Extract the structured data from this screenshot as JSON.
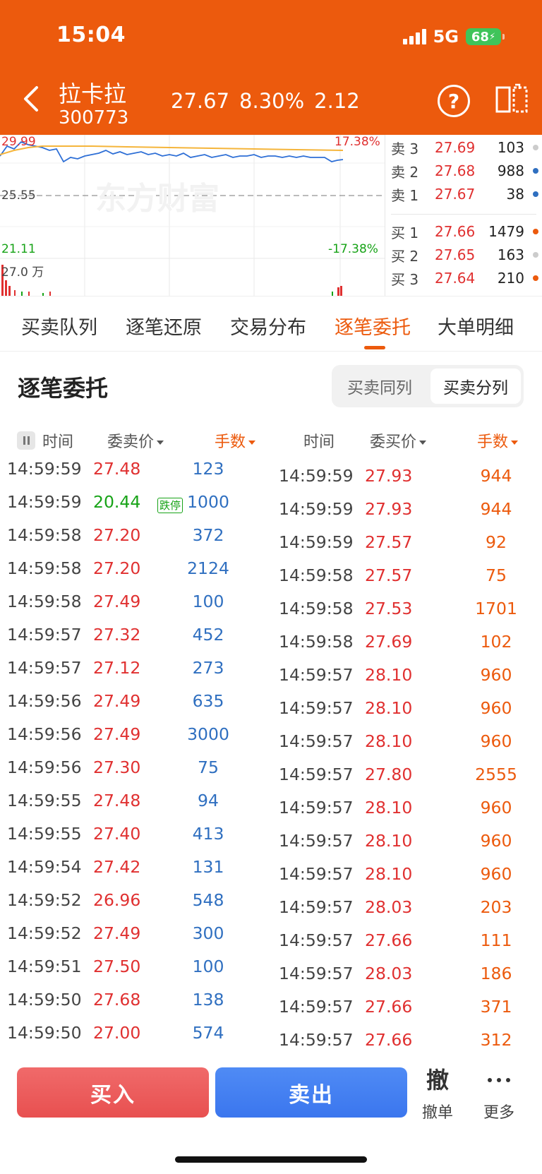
{
  "status": {
    "time": "15:04",
    "network": "5G",
    "battery": "68"
  },
  "header": {
    "name": "拉卡拉",
    "code": "300773",
    "price": "27.67",
    "pct": "8.30%",
    "change": "2.12",
    "help": "?"
  },
  "chart": {
    "watermark": "东方财富",
    "high": "29.99",
    "high_pct": "17.38%",
    "mid": "25.55",
    "low": "21.11",
    "low_pct": "-17.38%",
    "volume": "27.0 万"
  },
  "depth": {
    "asks": [
      {
        "label": "卖 3",
        "price": "27.69",
        "vol": "103",
        "dot": "#cccccc"
      },
      {
        "label": "卖 2",
        "price": "27.68",
        "vol": "988",
        "dot": "#2f6fc0"
      },
      {
        "label": "卖 1",
        "price": "27.67",
        "vol": "38",
        "dot": "#2f6fc0"
      }
    ],
    "bids": [
      {
        "label": "买 1",
        "price": "27.66",
        "vol": "1479",
        "dot": "#ec5a0d"
      },
      {
        "label": "买 2",
        "price": "27.65",
        "vol": "163",
        "dot": "#cccccc"
      },
      {
        "label": "买 3",
        "price": "27.64",
        "vol": "210",
        "dot": "#ec5a0d"
      }
    ]
  },
  "tabs": [
    "买卖队列",
    "逐笔还原",
    "交易分布",
    "逐笔委托",
    "大单明细"
  ],
  "section": {
    "title": "逐笔委托",
    "seg_same": "买卖同列",
    "seg_split": "买卖分列"
  },
  "columns": {
    "sell_time": "时间",
    "sell_price": "委卖价",
    "sell_vol": "手数",
    "buy_time": "时间",
    "buy_price": "委买价",
    "buy_vol": "手数"
  },
  "limit_down": "跌停",
  "sell_orders": [
    {
      "time": "14:59:59",
      "price": "27.48",
      "vol": "123",
      "color": "red"
    },
    {
      "time": "14:59:59",
      "price": "20.44",
      "vol": "1000",
      "color": "green",
      "limit": true
    },
    {
      "time": "14:59:58",
      "price": "27.20",
      "vol": "372",
      "color": "red"
    },
    {
      "time": "14:59:58",
      "price": "27.20",
      "vol": "2124",
      "color": "red"
    },
    {
      "time": "14:59:58",
      "price": "27.49",
      "vol": "100",
      "color": "red"
    },
    {
      "time": "14:59:57",
      "price": "27.32",
      "vol": "452",
      "color": "red"
    },
    {
      "time": "14:59:57",
      "price": "27.12",
      "vol": "273",
      "color": "red"
    },
    {
      "time": "14:59:56",
      "price": "27.49",
      "vol": "635",
      "color": "red"
    },
    {
      "time": "14:59:56",
      "price": "27.49",
      "vol": "3000",
      "color": "red"
    },
    {
      "time": "14:59:56",
      "price": "27.30",
      "vol": "75",
      "color": "red"
    },
    {
      "time": "14:59:55",
      "price": "27.48",
      "vol": "94",
      "color": "red"
    },
    {
      "time": "14:59:55",
      "price": "27.40",
      "vol": "413",
      "color": "red"
    },
    {
      "time": "14:59:54",
      "price": "27.42",
      "vol": "131",
      "color": "red"
    },
    {
      "time": "14:59:52",
      "price": "26.96",
      "vol": "548",
      "color": "red"
    },
    {
      "time": "14:59:52",
      "price": "27.49",
      "vol": "300",
      "color": "red"
    },
    {
      "time": "14:59:51",
      "price": "27.50",
      "vol": "100",
      "color": "red"
    },
    {
      "time": "14:59:50",
      "price": "27.68",
      "vol": "138",
      "color": "red"
    },
    {
      "time": "14:59:50",
      "price": "27.00",
      "vol": "574",
      "color": "red"
    }
  ],
  "buy_orders": [
    {
      "time": "14:59:59",
      "price": "27.93",
      "vol": "944"
    },
    {
      "time": "14:59:59",
      "price": "27.93",
      "vol": "944"
    },
    {
      "time": "14:59:59",
      "price": "27.57",
      "vol": "92"
    },
    {
      "time": "14:59:58",
      "price": "27.57",
      "vol": "75"
    },
    {
      "time": "14:59:58",
      "price": "27.53",
      "vol": "1701"
    },
    {
      "time": "14:59:58",
      "price": "27.69",
      "vol": "102"
    },
    {
      "time": "14:59:57",
      "price": "28.10",
      "vol": "960"
    },
    {
      "time": "14:59:57",
      "price": "28.10",
      "vol": "960"
    },
    {
      "time": "14:59:57",
      "price": "28.10",
      "vol": "960"
    },
    {
      "time": "14:59:57",
      "price": "27.80",
      "vol": "2555"
    },
    {
      "time": "14:59:57",
      "price": "28.10",
      "vol": "960"
    },
    {
      "time": "14:59:57",
      "price": "28.10",
      "vol": "960"
    },
    {
      "time": "14:59:57",
      "price": "28.10",
      "vol": "960"
    },
    {
      "time": "14:59:57",
      "price": "28.03",
      "vol": "203"
    },
    {
      "time": "14:59:57",
      "price": "27.66",
      "vol": "111"
    },
    {
      "time": "14:59:57",
      "price": "28.03",
      "vol": "186"
    },
    {
      "time": "14:59:57",
      "price": "27.66",
      "vol": "371"
    },
    {
      "time": "14:59:57",
      "price": "27.66",
      "vol": "312"
    }
  ],
  "bottom": {
    "buy": "买入",
    "sell": "卖出",
    "cancel_icon": "撤",
    "cancel": "撤单",
    "more": "更多"
  }
}
